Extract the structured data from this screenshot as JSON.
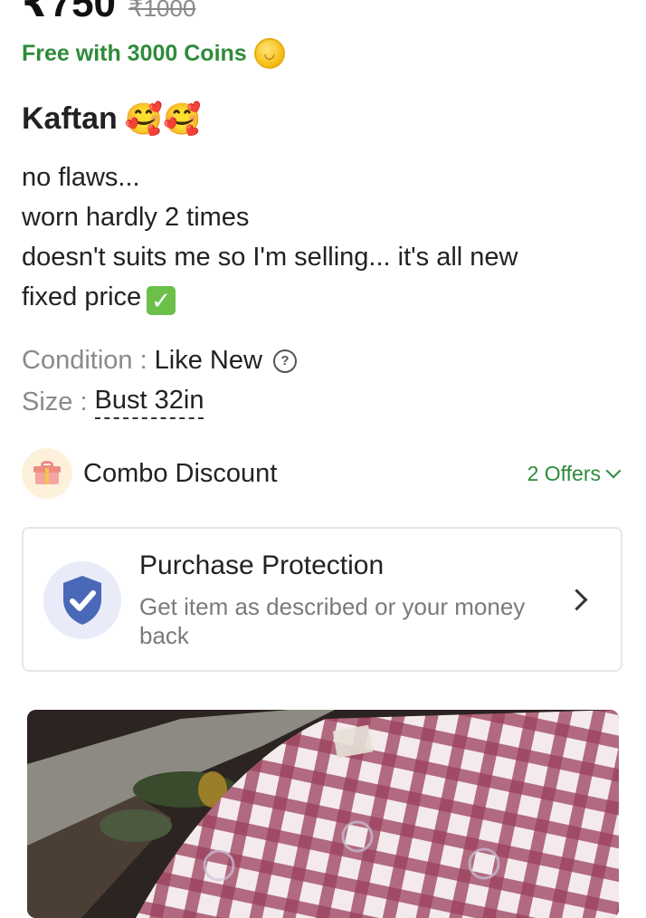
{
  "price": {
    "current": "₹750",
    "original": "₹1000"
  },
  "coins": {
    "text": "Free with 3000 Coins",
    "icon": "coin-icon"
  },
  "title": {
    "text": "Kaftan",
    "emoji": "🥰🥰"
  },
  "description": {
    "lines": [
      "no flaws...",
      "worn hardly 2 times",
      "doesn't suits me so I'm selling... it's all new",
      "fixed price"
    ],
    "check_icon": "check-mark-emoji"
  },
  "attributes": {
    "condition": {
      "key": "Condition :",
      "value": "Like New",
      "help_icon": "help-icon"
    },
    "size": {
      "key": "Size :",
      "value": "Bust 32in"
    }
  },
  "combo": {
    "label": "Combo Discount",
    "offers": "2 Offers",
    "icon": "gift-icon"
  },
  "protection": {
    "title": "Purchase Protection",
    "subtitle": "Get item as described or your money back",
    "icon": "shield-check-icon"
  },
  "colors": {
    "accent_green": "#2e8b3a",
    "shield_blue": "#4a68b8"
  }
}
